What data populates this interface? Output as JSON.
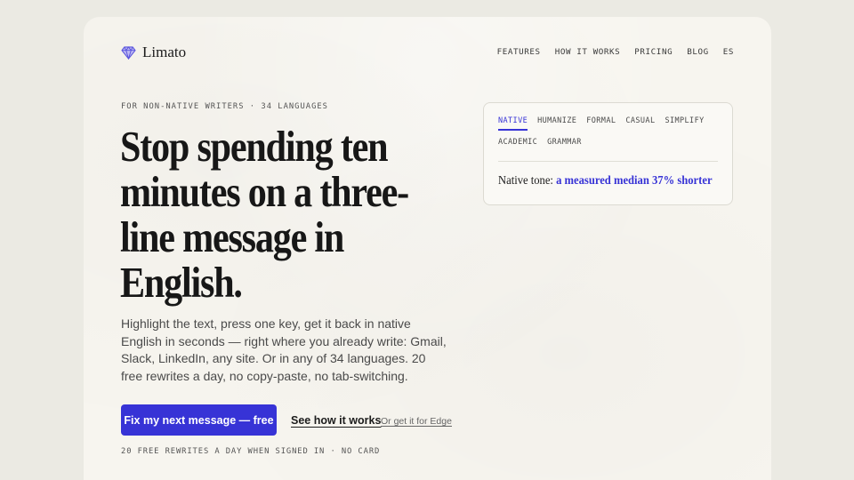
{
  "brand": {
    "name": "Limato",
    "icon": "gem-icon",
    "accent": "#3733d6"
  },
  "nav": [
    "FEATURES",
    "HOW IT WORKS",
    "PRICING",
    "BLOG",
    "ES"
  ],
  "hero": {
    "eyebrow": "FOR NON-NATIVE WRITERS · 34 LANGUAGES",
    "headline": "Stop spending ten minutes on a three-line message in English.",
    "body": "Highlight the text, press one key, get it back in native English in seconds — right where you already write: Gmail, Slack, LinkedIn, any site. Or in any of 34 languages. 20 free rewrites a day, no copy-paste, no tab-switching.",
    "cta_primary": "Fix my next message — free",
    "cta_secondary": "See how it works",
    "cta_tertiary": "Or get it for Edge",
    "footnote": "20 FREE REWRITES A DAY WHEN SIGNED IN · NO CARD"
  },
  "demo": {
    "tabs": [
      "NATIVE",
      "HUMANIZE",
      "FORMAL",
      "CASUAL",
      "SIMPLIFY",
      "ACADEMIC",
      "GRAMMAR"
    ],
    "active_tab": "NATIVE",
    "output_label": "Native tone:",
    "output_highlight": "a measured median 37% shorter"
  }
}
